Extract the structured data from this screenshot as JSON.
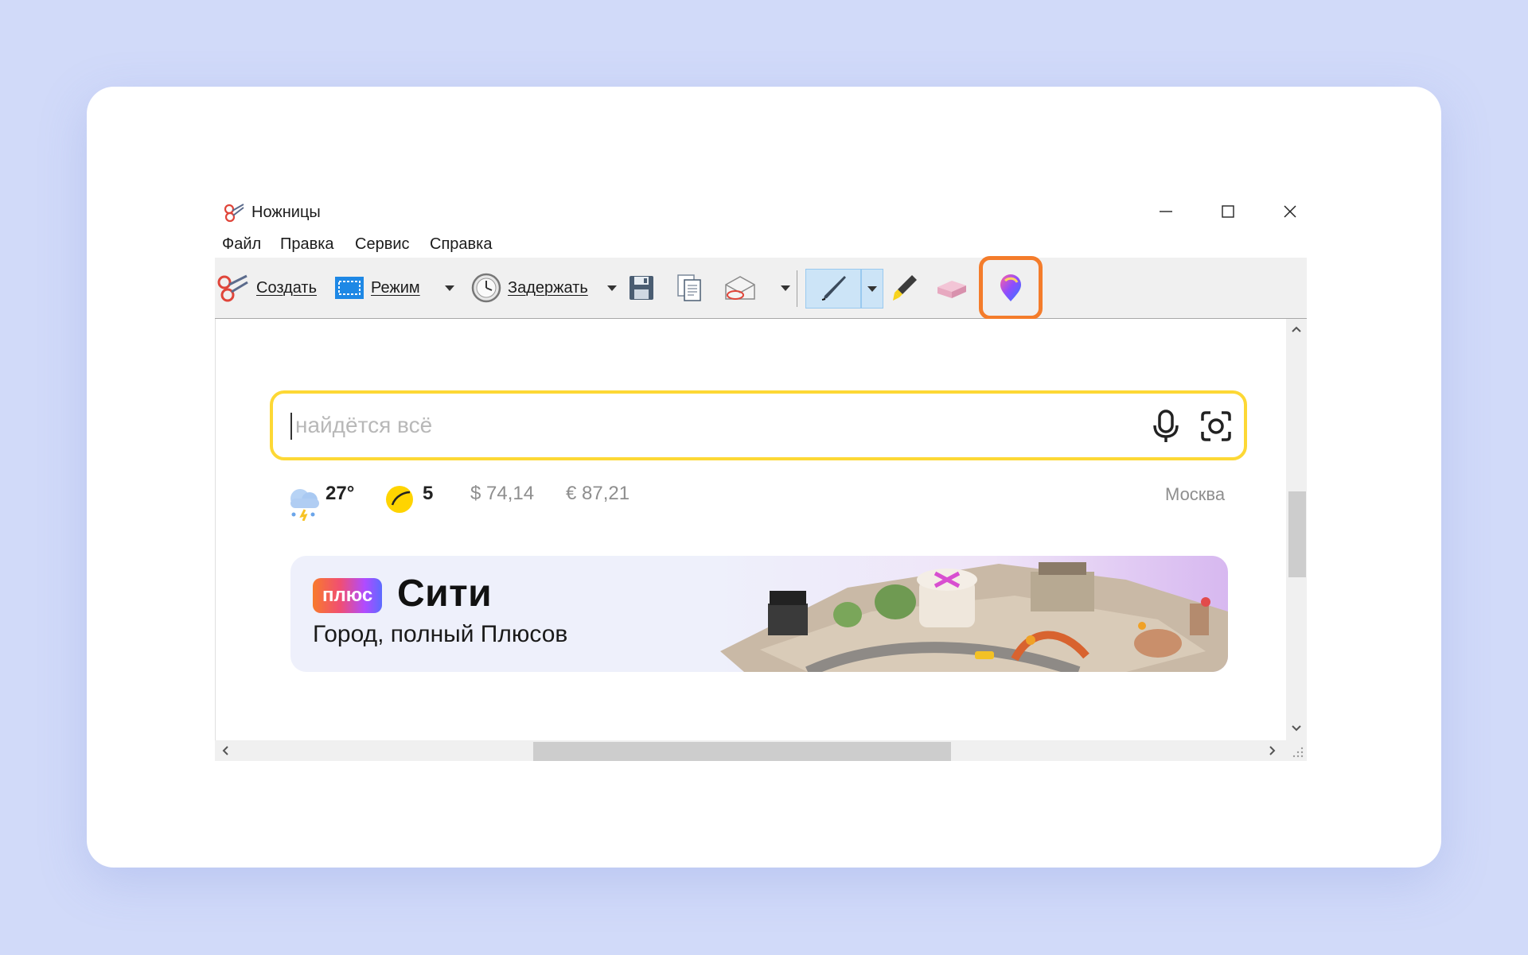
{
  "window": {
    "title": "Ножницы",
    "controls": [
      "minimize",
      "maximize",
      "close"
    ]
  },
  "menu": [
    "Файл",
    "Правка",
    "Сервис",
    "Справка"
  ],
  "toolbar": {
    "create_label": "Создать",
    "mode_label": "Режим",
    "delay_label": "Задержать",
    "icons": [
      "scissors-icon",
      "mode-rectangle-icon",
      "clock-icon",
      "save-icon",
      "copy-icon",
      "send-email-icon",
      "pen-icon",
      "highlighter-icon",
      "eraser-icon",
      "paint3d-icon"
    ],
    "highlight_color": "#f47c2b"
  },
  "page": {
    "search_placeholder": "найдётся всё",
    "weather_temp": "27°",
    "traffic_score": "5",
    "usd_rate": "$ 74,14",
    "eur_rate": "€ 87,21",
    "city": "Москва",
    "search_border_color": "#fdd835"
  },
  "banner": {
    "badge": "плюс",
    "title": "Сити",
    "subtitle": "Город, полный Плюсов"
  }
}
